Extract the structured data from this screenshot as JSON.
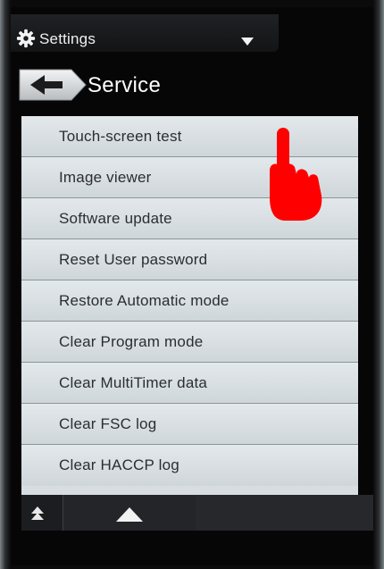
{
  "header": {
    "settings_label": "Settings",
    "settings_icon": "gear-icon",
    "dropdown_icon": "caret-down-icon"
  },
  "page": {
    "title": "Service",
    "back_icon": "back-arrow-icon"
  },
  "menu": {
    "items": [
      {
        "label": "Touch-screen test"
      },
      {
        "label": "Image viewer"
      },
      {
        "label": "Software update"
      },
      {
        "label": "Reset User password"
      },
      {
        "label": "Restore Automatic mode"
      },
      {
        "label": "Clear Program mode"
      },
      {
        "label": "Clear MultiTimer data"
      },
      {
        "label": "Clear FSC log"
      },
      {
        "label": "Clear HACCP log"
      }
    ]
  },
  "footer": {
    "first_icon": "scroll-to-top-icon",
    "up_icon": "scroll-up-icon"
  },
  "overlay": {
    "pointer_icon": "pointing-hand-icon",
    "color": "#ff0000"
  }
}
